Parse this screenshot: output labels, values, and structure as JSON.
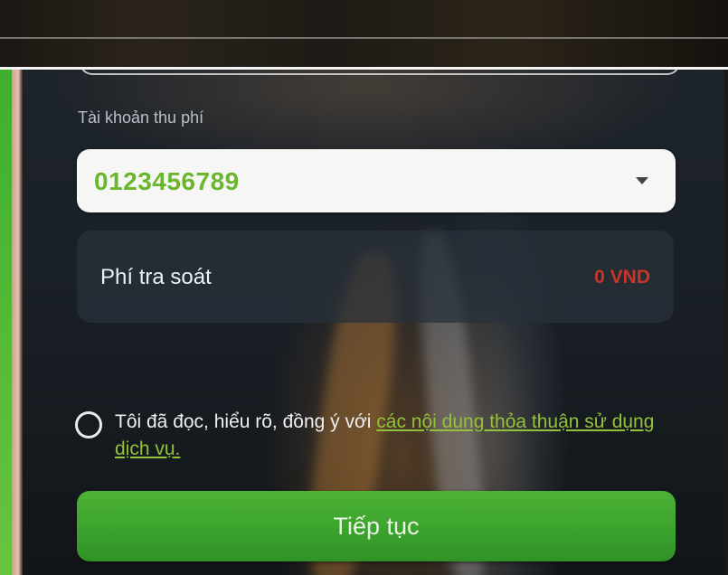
{
  "account": {
    "label": "Tài khoản thu phí",
    "value": "0123456789"
  },
  "fee": {
    "label": "Phí tra soát",
    "amount": "0 VND"
  },
  "agreement": {
    "text": "Tôi đã đọc, hiểu rõ, đồng ý với",
    "link_text": "các nội dung thỏa thuận sử dụng dịch vụ.",
    "checked": false
  },
  "actions": {
    "continue_label": "Tiếp tục"
  },
  "colors": {
    "account_value": "#6ab62d",
    "fee_amount": "#c8352b",
    "link": "#93c23a",
    "button": "#3aa12d"
  }
}
